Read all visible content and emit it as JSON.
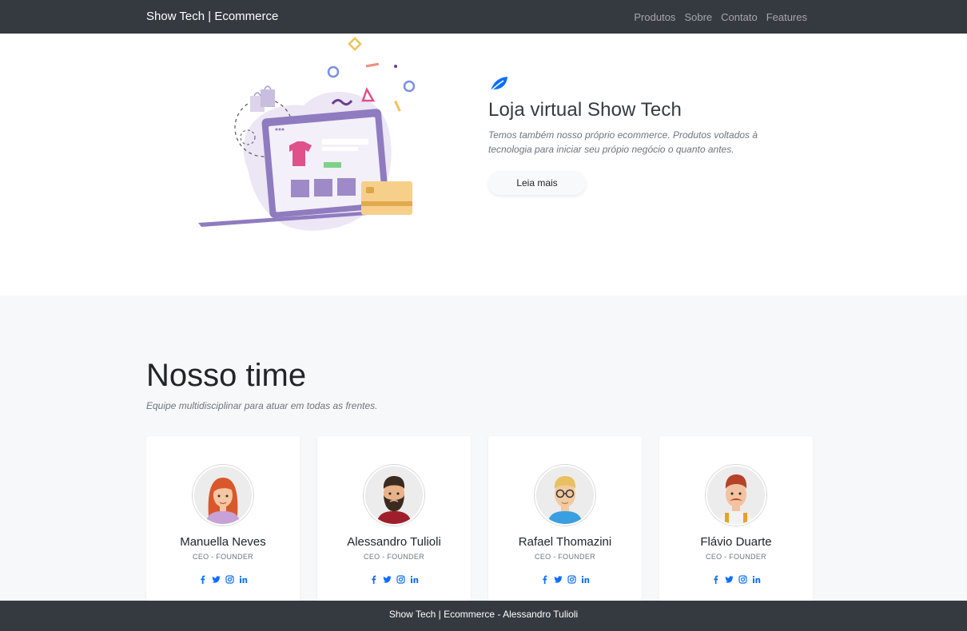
{
  "navbar": {
    "brand": "Show Tech | Ecommerce",
    "links": [
      "Produtos",
      "Sobre",
      "Contato",
      "Features"
    ]
  },
  "hero": {
    "icon": "leaf-icon",
    "title": "Loja virtual Show Tech",
    "description": "Temos também nosso próprio ecommerce. Produtos voltados à tecnologia para iniciar seu própio negócio o quanto antes.",
    "button_label": "Leia mais"
  },
  "team": {
    "title": "Nosso time",
    "subtitle": "Equipe multidisciplinar para atuar em todas as frentes.",
    "members": [
      {
        "name": "Manuella Neves",
        "role": "CEO - FOUNDER"
      },
      {
        "name": "Alessandro Tulioli",
        "role": "CEO - FOUNDER"
      },
      {
        "name": "Rafael Thomazini",
        "role": "CEO - FOUNDER"
      },
      {
        "name": "Flávio Duarte",
        "role": "CEO - FOUNDER"
      }
    ],
    "social_icons": [
      "facebook-icon",
      "twitter-icon",
      "instagram-icon",
      "linkedin-icon"
    ]
  },
  "footer": {
    "text": "Show Tech | Ecommerce - Alessandro Tulioli"
  },
  "colors": {
    "navbar_bg": "#343a40",
    "accent": "#0d6efd",
    "section_bg": "#f7f8fa"
  }
}
